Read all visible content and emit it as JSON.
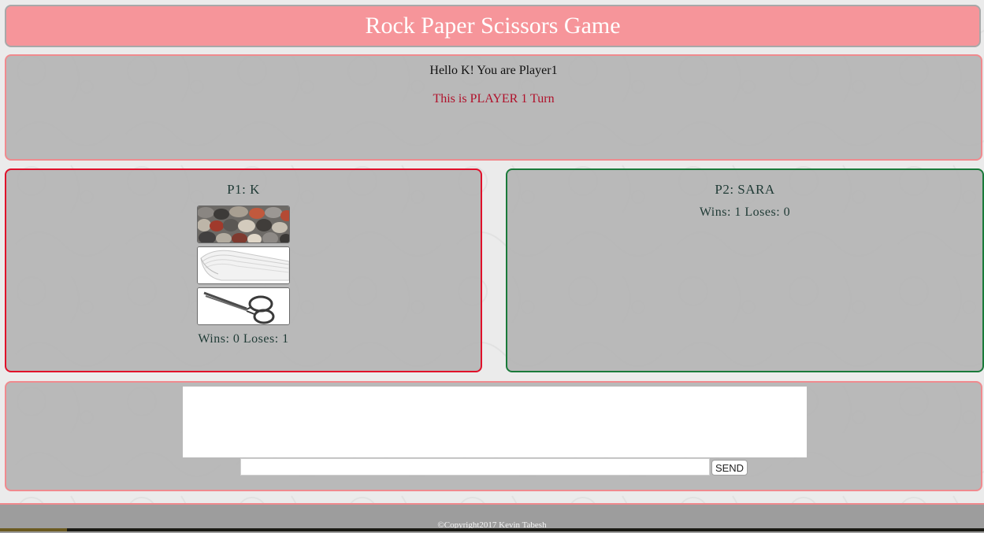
{
  "header": {
    "title": "Rock Paper Scissors Game"
  },
  "status": {
    "greeting": "Hello K! You are Player1",
    "turn": "This is PLAYER 1 Turn"
  },
  "player1": {
    "name": "P1: K",
    "choices": [
      {
        "label": "rock",
        "icon": "rock-icon"
      },
      {
        "label": "paper",
        "icon": "paper-icon"
      },
      {
        "label": "scissors",
        "icon": "scissors-icon"
      }
    ],
    "score": "Wins: 0 Loses: 1",
    "border_color": "#e0102a"
  },
  "player2": {
    "name": "P2: SARA",
    "score": "Wins: 1 Loses: 0",
    "border_color": "#1a7a3a"
  },
  "chat": {
    "message_value": "",
    "send_label": "SEND"
  },
  "footer": {
    "copyright": "©Copyright2017 Kevin Tabesh"
  },
  "colors": {
    "header_bg": "#f6959a",
    "panel_bg": "#b4b4b4",
    "turn_text": "#b0102a",
    "footer_bg": "#9d9d9d"
  }
}
